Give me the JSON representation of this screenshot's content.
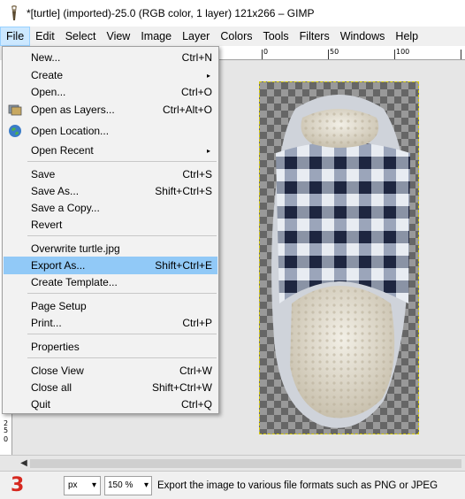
{
  "window": {
    "title": "*[turtle] (imported)-25.0 (RGB color, 1 layer) 121x266 – GIMP"
  },
  "menubar": [
    {
      "label": "File"
    },
    {
      "label": "Edit"
    },
    {
      "label": "Select"
    },
    {
      "label": "View"
    },
    {
      "label": "Image"
    },
    {
      "label": "Layer"
    },
    {
      "label": "Colors"
    },
    {
      "label": "Tools"
    },
    {
      "label": "Filters"
    },
    {
      "label": "Windows"
    },
    {
      "label": "Help"
    }
  ],
  "file_menu": {
    "items": [
      {
        "label": "New...",
        "shortcut": "Ctrl+N"
      },
      {
        "label": "Create",
        "shortcut": ""
      },
      {
        "label": "Open...",
        "shortcut": "Ctrl+O"
      },
      {
        "label": "Open as Layers...",
        "shortcut": "Ctrl+Alt+O"
      },
      {
        "label": "Open Location...",
        "shortcut": ""
      },
      {
        "label": "Open Recent",
        "shortcut": ""
      },
      {
        "label": "Save",
        "shortcut": "Ctrl+S"
      },
      {
        "label": "Save As...",
        "shortcut": "Shift+Ctrl+S"
      },
      {
        "label": "Save a Copy...",
        "shortcut": ""
      },
      {
        "label": "Revert",
        "shortcut": ""
      },
      {
        "label": "Overwrite turtle.jpg",
        "shortcut": ""
      },
      {
        "label": "Export As...",
        "shortcut": "Shift+Ctrl+E"
      },
      {
        "label": "Create Template...",
        "shortcut": ""
      },
      {
        "label": "Page Setup",
        "shortcut": ""
      },
      {
        "label": "Print...",
        "shortcut": "Ctrl+P"
      },
      {
        "label": "Properties",
        "shortcut": ""
      },
      {
        "label": "Close View",
        "shortcut": "Ctrl+W"
      },
      {
        "label": "Close all",
        "shortcut": "Shift+Ctrl+W"
      },
      {
        "label": "Quit",
        "shortcut": "Ctrl+Q"
      }
    ],
    "submenu_arrow": "▸"
  },
  "ruler": {
    "h_labels": [
      "0",
      "50",
      "100"
    ],
    "v_labels": [
      "2",
      "5",
      "0"
    ]
  },
  "statusbar": {
    "step": "3",
    "unit": "px",
    "zoom": "150 %",
    "hint": "Export the image to various file formats such as PNG or JPEG"
  },
  "colors": {
    "highlight": "#91c9f7",
    "menubar_active": "#cce8ff",
    "step_red": "#d6281f"
  }
}
